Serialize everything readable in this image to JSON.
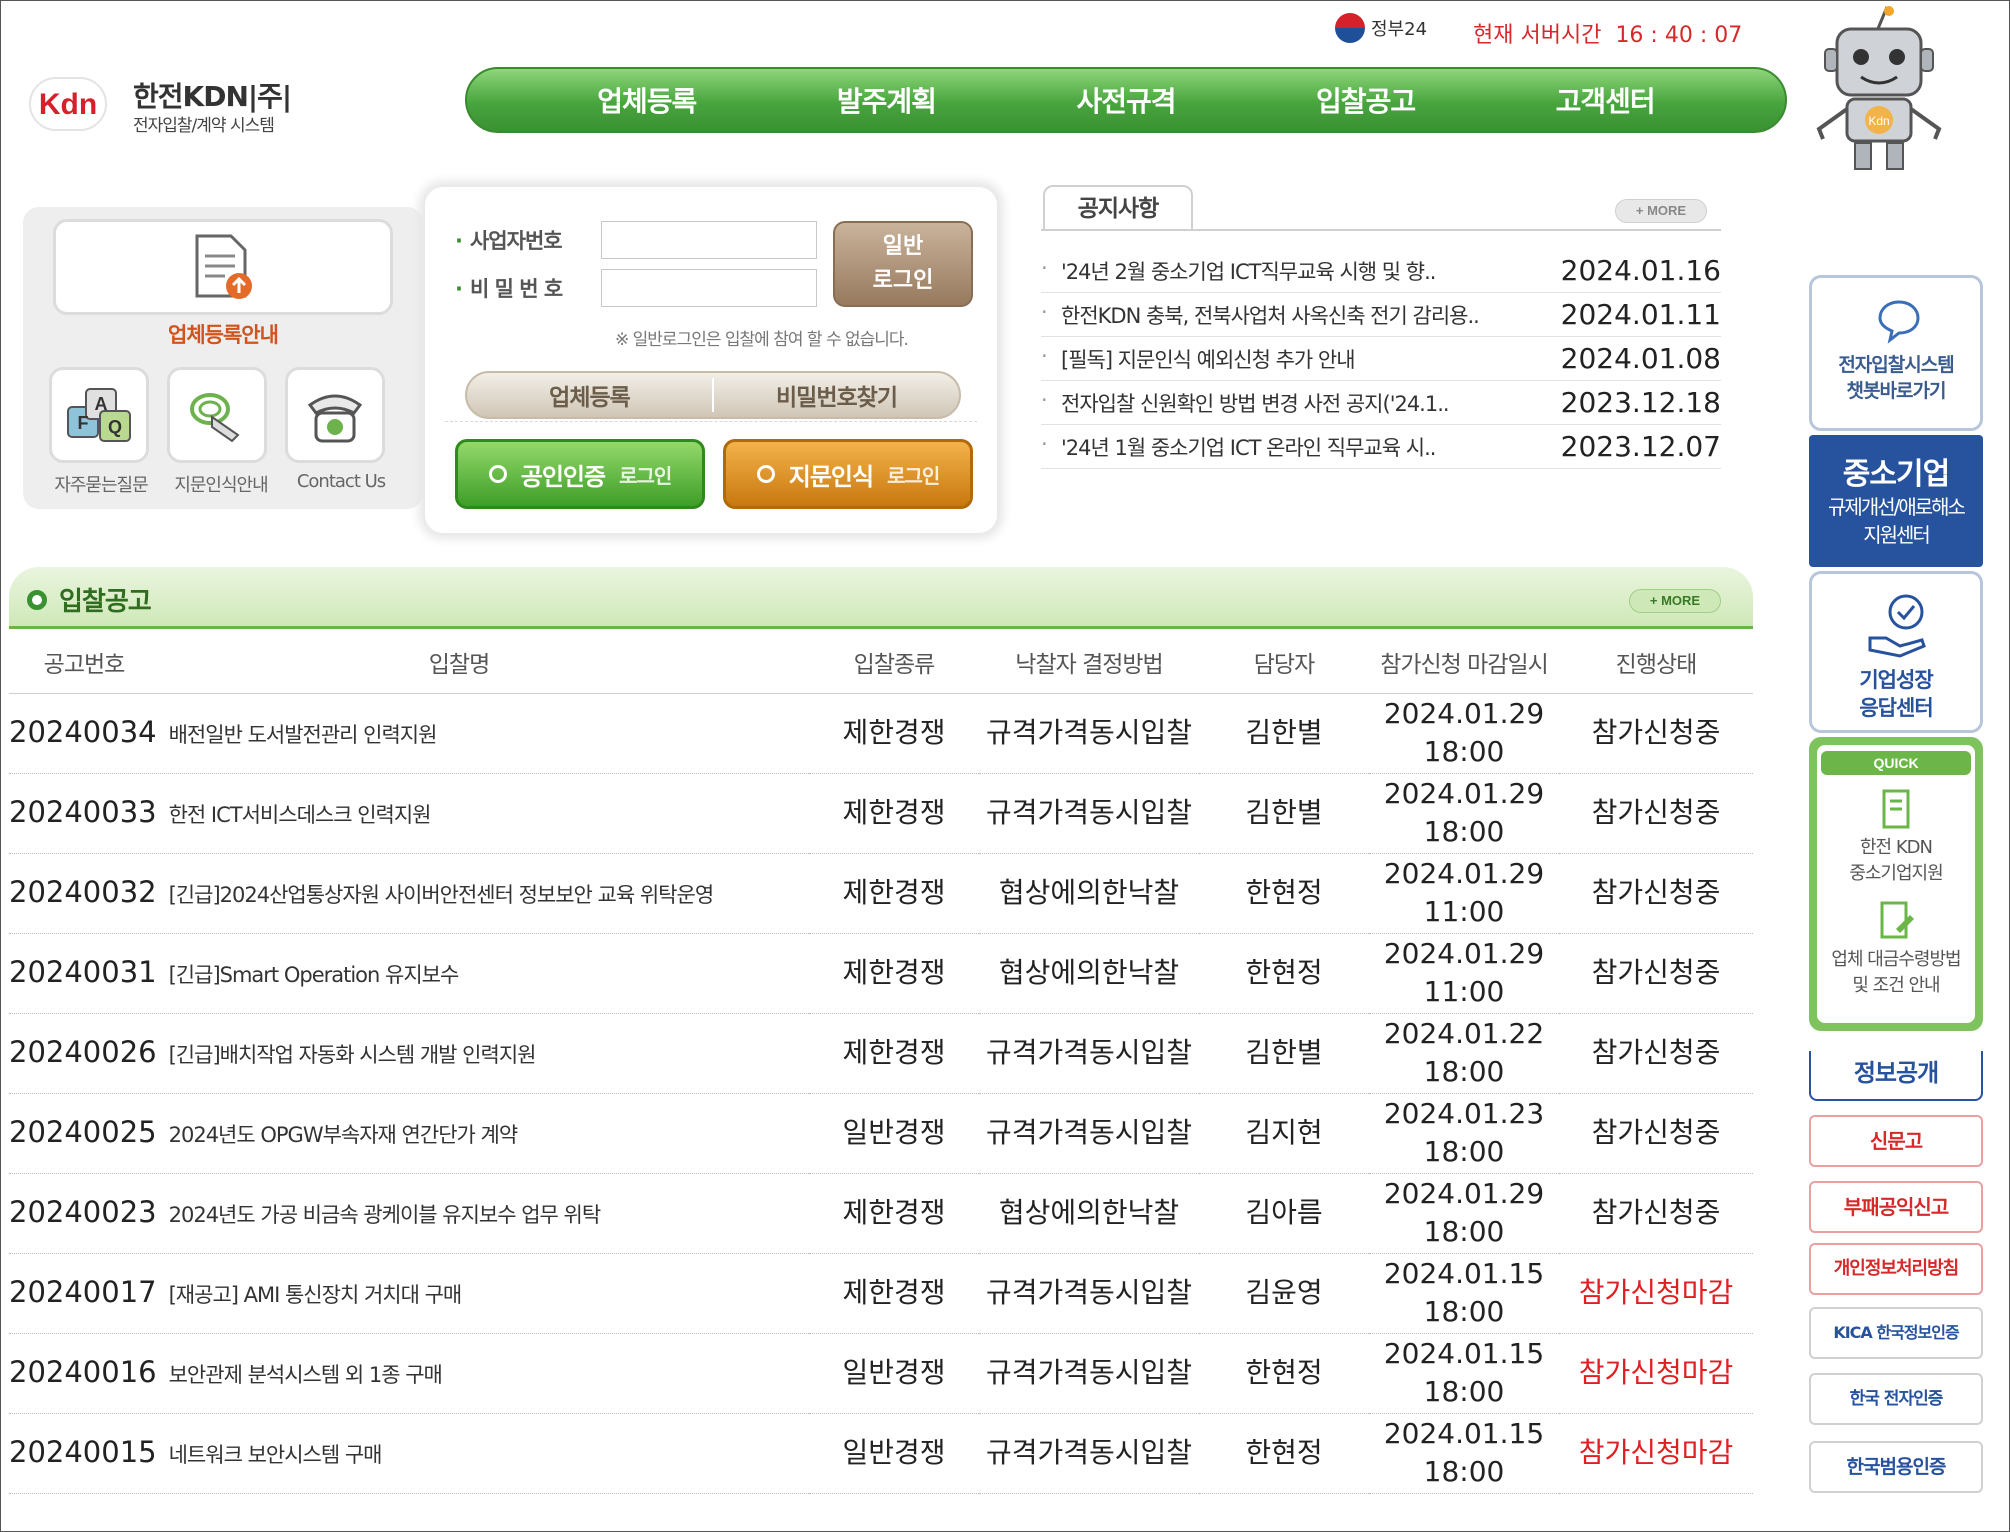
{
  "header": {
    "logo_mark": "Kdn",
    "logo_title": "한전KDN|주|",
    "logo_subtitle": "전자입찰/계약 시스템",
    "gov24": "정부24",
    "server_time_label": "현재 서버시간",
    "server_time": "16 : 40 : 07"
  },
  "nav": [
    "업체등록",
    "발주계획",
    "사전규격",
    "입찰공고",
    "고객센터"
  ],
  "robot_badge": "Kdn",
  "quick_box": {
    "register_guide": "업체등록안내",
    "items": [
      "자주묻는질문",
      "지문인식안내",
      "Contact Us"
    ],
    "icons": [
      "document-upload-icon",
      "faq-icon",
      "fingerprint-icon",
      "phone-icon"
    ]
  },
  "login": {
    "business_no_label": "사업자번호",
    "password_label": "비 밀 번 호",
    "business_no_value": "",
    "password_value": "",
    "general_login_line1": "일반",
    "general_login_line2": "로그인",
    "note": "※ 일반로그인은 입찰에 참여 할 수 없습니다.",
    "register_btn": "업체등록",
    "find_pw_btn": "비밀번호찾기",
    "cert_main": "공인인증",
    "cert_sub": "로그인",
    "finger_main": "지문인식",
    "finger_sub": "로그인"
  },
  "notice": {
    "tab": "공지사항",
    "more": "+ MORE",
    "items": [
      {
        "title": "'24년 2월 중소기업 ICT직무교육 시행 및 향..",
        "date": "2024.01.16"
      },
      {
        "title": "한전KDN 충북, 전북사업처 사옥신축 전기 감리용..",
        "date": "2024.01.11"
      },
      {
        "title": "[필독] 지문인식 예외신청 추가 안내",
        "date": "2024.01.08"
      },
      {
        "title": "전자입찰 신원확인 방법 변경 사전 공지('24.1..",
        "date": "2023.12.18"
      },
      {
        "title": "'24년 1월 중소기업 ICT 온라인 직무교육 시..",
        "date": "2023.12.07"
      }
    ]
  },
  "bids": {
    "title": "입찰공고",
    "more": "+ MORE",
    "columns": [
      "공고번호",
      "입찰명",
      "입찰종류",
      "낙찰자 결정방법",
      "담당자",
      "참가신청 마감일시",
      "진행상태"
    ],
    "rows": [
      {
        "no": "20240034",
        "name": "배전일반 도서발전관리 인력지원",
        "type": "제한경쟁",
        "method": "규격가격동시입찰",
        "manager": "김한별",
        "deadline_date": "2024.01.29",
        "deadline_time": "18:00",
        "status": "참가신청중",
        "closed": false
      },
      {
        "no": "20240033",
        "name": "한전 ICT서비스데스크 인력지원",
        "type": "제한경쟁",
        "method": "규격가격동시입찰",
        "manager": "김한별",
        "deadline_date": "2024.01.29",
        "deadline_time": "18:00",
        "status": "참가신청중",
        "closed": false
      },
      {
        "no": "20240032",
        "name": "[긴급]2024산업통상자원 사이버안전센터 정보보안 교육 위탁운영",
        "type": "제한경쟁",
        "method": "협상에의한낙찰",
        "manager": "한현정",
        "deadline_date": "2024.01.29",
        "deadline_time": "11:00",
        "status": "참가신청중",
        "closed": false
      },
      {
        "no": "20240031",
        "name": "[긴급]Smart Operation 유지보수",
        "type": "제한경쟁",
        "method": "협상에의한낙찰",
        "manager": "한현정",
        "deadline_date": "2024.01.29",
        "deadline_time": "11:00",
        "status": "참가신청중",
        "closed": false
      },
      {
        "no": "20240026",
        "name": "[긴급]배치작업 자동화 시스템 개발 인력지원",
        "type": "제한경쟁",
        "method": "규격가격동시입찰",
        "manager": "김한별",
        "deadline_date": "2024.01.22",
        "deadline_time": "18:00",
        "status": "참가신청중",
        "closed": false
      },
      {
        "no": "20240025",
        "name": "2024년도 OPGW부속자재 연간단가 계약",
        "type": "일반경쟁",
        "method": "규격가격동시입찰",
        "manager": "김지현",
        "deadline_date": "2024.01.23",
        "deadline_time": "18:00",
        "status": "참가신청중",
        "closed": false
      },
      {
        "no": "20240023",
        "name": "2024년도 가공 비금속 광케이블 유지보수 업무 위탁",
        "type": "제한경쟁",
        "method": "협상에의한낙찰",
        "manager": "김아름",
        "deadline_date": "2024.01.29",
        "deadline_time": "18:00",
        "status": "참가신청중",
        "closed": false
      },
      {
        "no": "20240017",
        "name": "[재공고] AMI 통신장치 거치대 구매",
        "type": "제한경쟁",
        "method": "규격가격동시입찰",
        "manager": "김윤영",
        "deadline_date": "2024.01.15",
        "deadline_time": "18:00",
        "status": "참가신청마감",
        "closed": true
      },
      {
        "no": "20240016",
        "name": "보안관제 분석시스템 외 1종 구매",
        "type": "일반경쟁",
        "method": "규격가격동시입찰",
        "manager": "한현정",
        "deadline_date": "2024.01.15",
        "deadline_time": "18:00",
        "status": "참가신청마감",
        "closed": true
      },
      {
        "no": "20240015",
        "name": "네트워크 보안시스템 구매",
        "type": "일반경쟁",
        "method": "규격가격동시입찰",
        "manager": "한현정",
        "deadline_date": "2024.01.15",
        "deadline_time": "18:00",
        "status": "참가신청마감",
        "closed": true
      }
    ]
  },
  "rail": {
    "chatbot_line1": "전자입찰시스템",
    "chatbot_line2": "챗봇바로가기",
    "sme_big": "중소기업",
    "sme_line1": "규제개선/애로해소",
    "sme_line2": "지원센터",
    "growth_line1": "기업성장",
    "growth_line2": "응답센터",
    "quick_tag": "QUICK",
    "quick_item1_line1": "한전 KDN",
    "quick_item1_line2": "중소기업지원",
    "quick_item2_line1": "업체 대금수령방법",
    "quick_item2_line2": "및 조건 안내",
    "info_open": "정보공개",
    "links": [
      "신문고",
      "부패공익신고",
      "개인정보처리방침",
      "KICA 한국정보인증",
      "한국 전자인증",
      "한국범용인증"
    ]
  },
  "colors": {
    "accent_green": "#48a53e",
    "closed_red": "#e02020",
    "brand_blue": "#27529e"
  }
}
